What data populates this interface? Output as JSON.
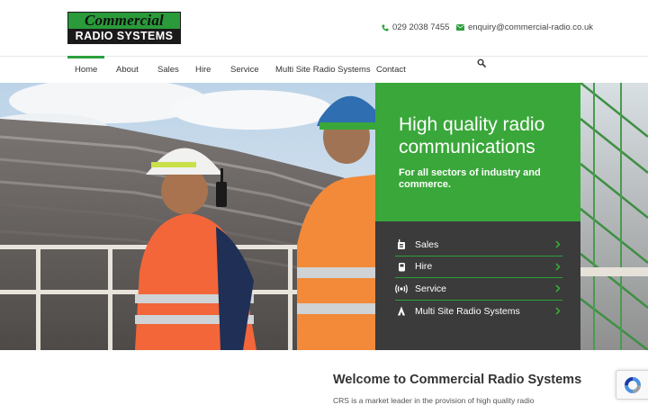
{
  "header": {
    "logo_line1": "Commercial",
    "logo_line2": "RADIO SYSTEMS",
    "phone": "029 2038 7455",
    "email": "enquiry@commercial-radio.co.uk"
  },
  "nav": {
    "items": [
      {
        "label": "Home",
        "active": true
      },
      {
        "label": "About"
      },
      {
        "label": "Sales"
      },
      {
        "label": "Hire"
      },
      {
        "label": "Service"
      },
      {
        "label": "Multi Site Radio Systems"
      },
      {
        "label": "Contact"
      }
    ],
    "search_icon": "search-icon"
  },
  "hero": {
    "title": "High quality radio communications",
    "subtitle": "For all sectors of industry and commerce.",
    "services": [
      {
        "label": "Sales",
        "icon": "radio-icon"
      },
      {
        "label": "Hire",
        "icon": "handset-icon"
      },
      {
        "label": "Service",
        "icon": "broadcast-icon"
      },
      {
        "label": "Multi Site Radio Systems",
        "icon": "tower-icon"
      }
    ]
  },
  "welcome": {
    "title": "Welcome to Commercial Radio Systems",
    "text": "CRS is a market leader in the provision of high quality radio"
  },
  "colors": {
    "brand_green": "#3aa73a",
    "accent_green": "#2ca03c",
    "panel_dark": "#3b3b3b"
  }
}
